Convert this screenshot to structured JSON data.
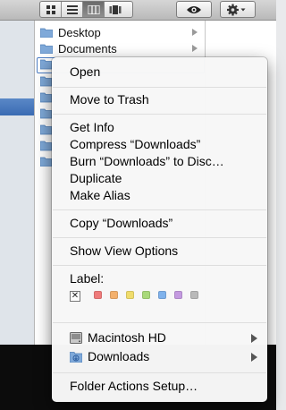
{
  "toolbar": {
    "view_buttons": [
      "icon-view-icon",
      "list-view-icon",
      "column-view-icon",
      "cover-flow-icon"
    ],
    "active_view": "column-view-icon",
    "quicklook_icon": "eye-icon",
    "action_icon": "gear-icon"
  },
  "column": {
    "items": [
      {
        "label": "Desktop",
        "icon": "folder-icon"
      },
      {
        "label": "Documents",
        "icon": "folder-icon"
      }
    ]
  },
  "context_menu": {
    "open": "Open",
    "move_to_trash": "Move to Trash",
    "get_info": "Get Info",
    "compress": "Compress “Downloads”",
    "burn": "Burn “Downloads” to Disc…",
    "duplicate": "Duplicate",
    "make_alias": "Make Alias",
    "copy": "Copy “Downloads”",
    "show_view_options": "Show View Options",
    "label_heading": "Label:",
    "label_colors": [
      "#ef7b7b",
      "#f3b06c",
      "#f0dc6c",
      "#a9d97a",
      "#7fb2ec",
      "#c49ae0",
      "#b9b9b9"
    ],
    "services": [
      {
        "label": "Macintosh HD",
        "icon": "hard-drive-icon"
      },
      {
        "label": "Downloads",
        "icon": "downloads-folder-icon"
      }
    ],
    "folder_actions": "Folder Actions Setup…"
  }
}
